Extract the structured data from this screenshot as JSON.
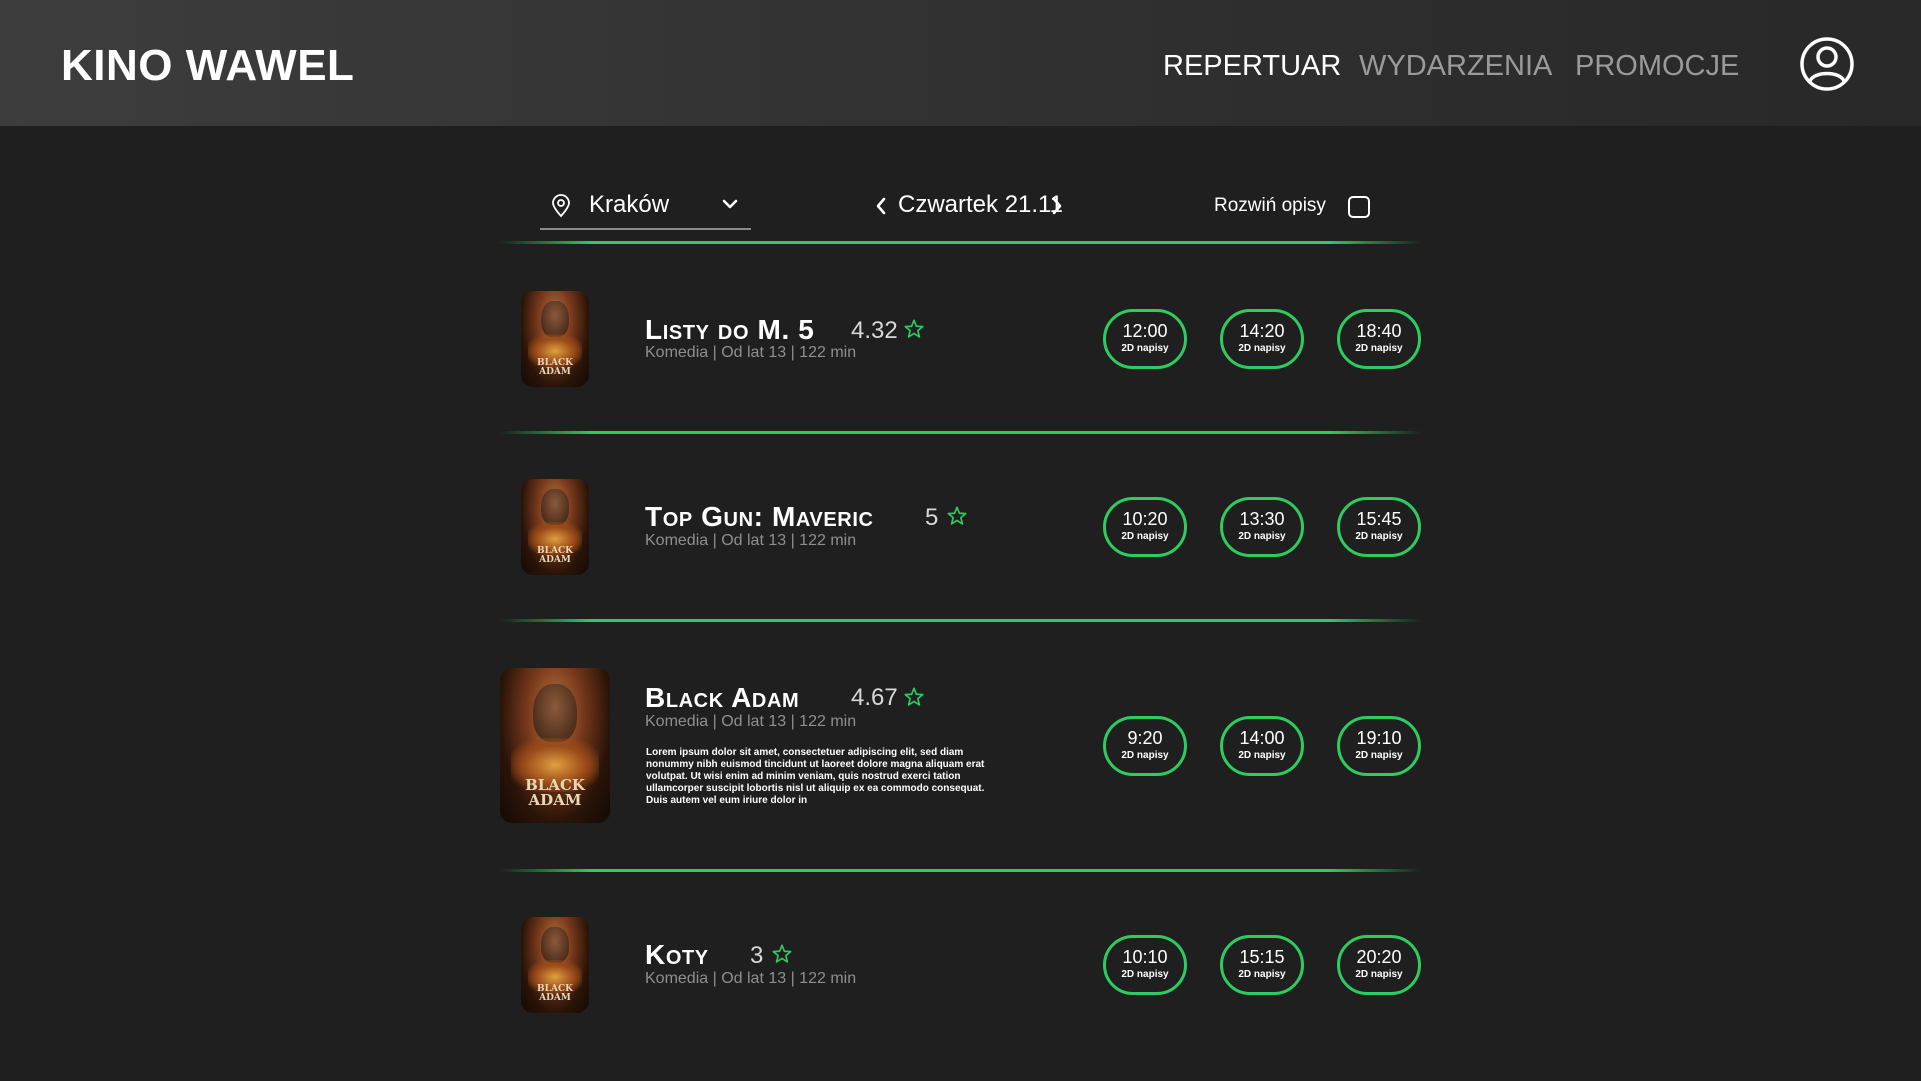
{
  "header": {
    "brand": "KINO WAWEL",
    "nav": [
      {
        "label": "REPERTUAR",
        "active": true
      },
      {
        "label": "WYDARZENIA",
        "active": false
      },
      {
        "label": "PROMOCJE",
        "active": false
      }
    ],
    "user_icon": "user-circle-icon"
  },
  "filters": {
    "city": "Kraków",
    "city_icon": "location-pin-icon",
    "dropdown_icon": "chevron-down-icon",
    "date": "Czwartek 21.11",
    "expand_label": "Rozwiń opisy",
    "expand_checked": false
  },
  "colors": {
    "accent": "#2ecc60",
    "background": "#1f1f1f",
    "header_bg": "#333333",
    "muted_text": "#8f8f8f"
  },
  "movies": [
    {
      "title": "Listy do M. 5",
      "rating": "4.32",
      "meta": "Komedia | Od lat 13 | 122 min",
      "poster_text": "BLACK ADAM",
      "showtimes": [
        {
          "time": "12:00",
          "format": "2D napisy"
        },
        {
          "time": "14:20",
          "format": "2D napisy"
        },
        {
          "time": "18:40",
          "format": "2D napisy"
        }
      ]
    },
    {
      "title": "Top Gun: Maveric",
      "rating": "5",
      "meta": "Komedia | Od lat 13 | 122 min",
      "poster_text": "BLACK ADAM",
      "showtimes": [
        {
          "time": "10:20",
          "format": "2D napisy"
        },
        {
          "time": "13:30",
          "format": "2D napisy"
        },
        {
          "time": "15:45",
          "format": "2D napisy"
        }
      ]
    },
    {
      "title": "Black Adam",
      "rating": "4.67",
      "meta": "Komedia | Od lat 13 | 122 min",
      "description": "Lorem ipsum dolor sit amet, consectetuer adipiscing elit, sed diam nonummy nibh euismod tincidunt ut laoreet dolore magna aliquam erat volutpat. Ut wisi enim ad minim veniam, quis nostrud exerci tation ullamcorper suscipit lobortis nisl ut aliquip ex ea commodo consequat. Duis autem vel eum iriure dolor in",
      "poster_text": "BLACK ADAM",
      "showtimes": [
        {
          "time": "9:20",
          "format": "2D napisy"
        },
        {
          "time": "14:00",
          "format": "2D napisy"
        },
        {
          "time": "19:10",
          "format": "2D napisy"
        }
      ]
    },
    {
      "title": "Koty",
      "rating": "3",
      "meta": "Komedia | Od lat 13 | 122 min",
      "poster_text": "BLACK ADAM",
      "showtimes": [
        {
          "time": "10:10",
          "format": "2D napisy"
        },
        {
          "time": "15:15",
          "format": "2D napisy"
        },
        {
          "time": "20:20",
          "format": "2D napisy"
        }
      ]
    }
  ]
}
